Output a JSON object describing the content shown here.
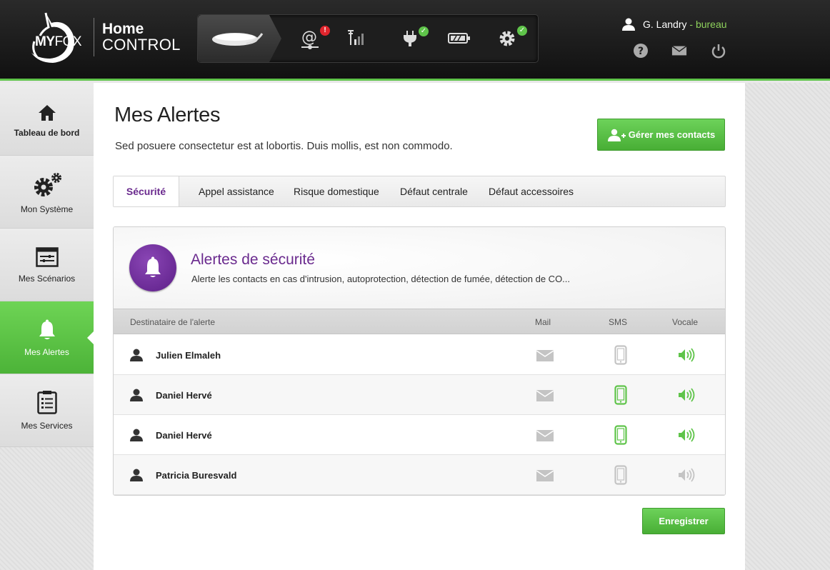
{
  "brand": {
    "logo_text_bold": "MY",
    "logo_text_light": "FOX",
    "line1": "Home",
    "line2": "CONTROL"
  },
  "status": {
    "email_badge": "!"
  },
  "user": {
    "name": "G. Landry",
    "separator": " - ",
    "location": "bureau"
  },
  "sidebar": {
    "items": [
      {
        "label": "Tableau de bord",
        "icon": "home-icon"
      },
      {
        "label": "Mon Système",
        "icon": "gears-icon"
      },
      {
        "label": "Mes Scénarios",
        "icon": "scenario-icon"
      },
      {
        "label": "Mes Alertes",
        "icon": "bell-icon",
        "active": true
      },
      {
        "label": "Mes Services",
        "icon": "clipboard-icon"
      }
    ]
  },
  "page": {
    "title": "Mes Alertes",
    "subtitle": "Sed posuere consectetur est at lobortis. Duis mollis, est non commodo.",
    "contacts_button": "Gérer mes contacts",
    "save_button": "Enregistrer"
  },
  "tabs": [
    "Sécurité",
    "Appel assistance",
    "Risque domestique",
    "Défaut centrale",
    "Défaut accessoires"
  ],
  "panel": {
    "title": "Alertes de sécurité",
    "description": "Alerte les contacts en cas d'intrusion, autoprotection, détection de fumée, détection de CO..."
  },
  "table": {
    "headers": {
      "recipient": "Destinataire de l'alerte",
      "mail": "Mail",
      "sms": "SMS",
      "vocal": "Vocale"
    },
    "rows": [
      {
        "name": "Julien Elmaleh",
        "mail": false,
        "sms": false,
        "vocal": true
      },
      {
        "name": "Daniel Hervé",
        "mail": false,
        "sms": true,
        "vocal": true
      },
      {
        "name": "Daniel Hervé",
        "mail": false,
        "sms": true,
        "vocal": true
      },
      {
        "name": "Patricia Buresvald",
        "mail": false,
        "sms": false,
        "vocal": false
      }
    ]
  },
  "colors": {
    "accent_green": "#5fc44a",
    "accent_purple": "#6a2a8e",
    "inactive_gray": "#c4c4c4",
    "alert_red": "#e0252d"
  }
}
